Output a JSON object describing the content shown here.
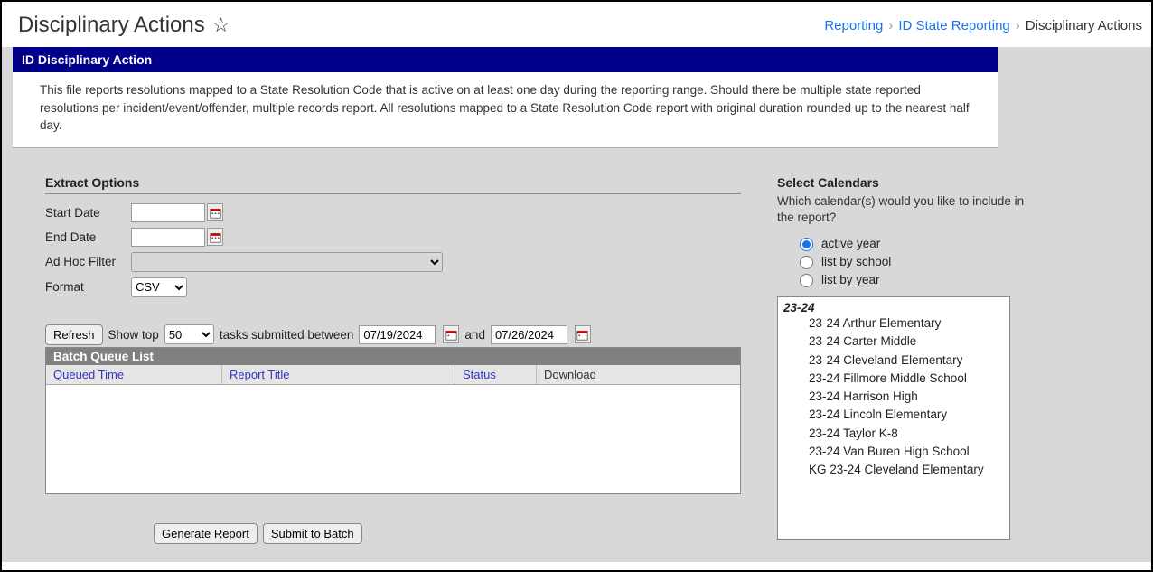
{
  "header": {
    "title": "Disciplinary Actions",
    "breadcrumb": {
      "a": "Reporting",
      "b": "ID State Reporting",
      "c": "Disciplinary Actions"
    }
  },
  "panel": {
    "title": "ID Disciplinary Action",
    "description": "This file reports resolutions mapped to a State Resolution Code that is active on at least one day during the reporting range. Should there be multiple state reported resolutions per incident/event/offender, multiple records report. All resolutions mapped to a State Resolution Code report with original duration rounded up to the nearest half day."
  },
  "extract": {
    "section": "Extract Options",
    "startDateLabel": "Start Date",
    "endDateLabel": "End Date",
    "adHocLabel": "Ad Hoc Filter",
    "formatLabel": "Format",
    "formatValue": "CSV",
    "startDate": "",
    "endDate": ""
  },
  "batch": {
    "refresh": "Refresh",
    "showTop": "Show top",
    "topValue": "50",
    "tasks1": "tasks submitted between",
    "date1": "07/19/2024",
    "and": "and",
    "date2": "07/26/2024",
    "title": "Batch Queue List",
    "colQueued": "Queued Time",
    "colReport": "Report Title",
    "colStatus": "Status",
    "colDownload": "Download"
  },
  "actions": {
    "generate": "Generate Report",
    "submit": "Submit to Batch"
  },
  "calendars": {
    "section": "Select Calendars",
    "prompt": "Which calendar(s) would you like to include in the report?",
    "opt1": "active year",
    "opt2": "list by school",
    "opt3": "list by year",
    "year": "23-24",
    "items": [
      "23-24 Arthur Elementary",
      "23-24 Carter Middle",
      "23-24 Cleveland Elementary",
      "23-24 Fillmore Middle School",
      "23-24 Harrison High",
      "23-24 Lincoln Elementary",
      "23-24 Taylor K-8",
      "23-24 Van Buren High School",
      "KG 23-24 Cleveland Elementary"
    ]
  }
}
